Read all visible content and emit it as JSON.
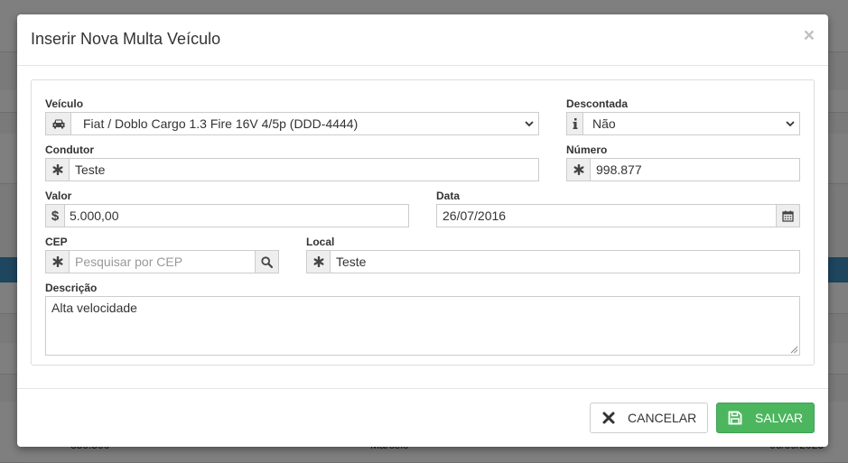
{
  "modal": {
    "title": "Inserir Nova Multa Veículo",
    "close_label": "×"
  },
  "form": {
    "veiculo": {
      "label": "Veículo",
      "value": "Fiat / Doblo Cargo 1.3 Fire 16V 4/5p (DDD-4444)",
      "icon": "car-icon"
    },
    "descontada": {
      "label": "Descontada",
      "value": "Não",
      "icon": "info-icon"
    },
    "condutor": {
      "label": "Condutor",
      "value": "Teste",
      "icon": "asterisk-icon"
    },
    "numero": {
      "label": "Número",
      "value": "998.877",
      "icon": "asterisk-icon"
    },
    "valor": {
      "label": "Valor",
      "value": "5.000,00",
      "icon": "dollar-icon"
    },
    "data": {
      "label": "Data",
      "value": "26/07/2016",
      "icon": "calendar-icon"
    },
    "cep": {
      "label": "CEP",
      "placeholder": "Pesquisar por CEP",
      "icon": "asterisk-icon",
      "search_icon": "search-icon"
    },
    "local": {
      "label": "Local",
      "value": "Teste",
      "icon": "asterisk-icon"
    },
    "descricao": {
      "label": "Descrição",
      "value": "Alta velocidade"
    }
  },
  "footer": {
    "cancel_label": "CANCELAR",
    "save_label": "SALVAR"
  },
  "background": {
    "row_left": "350.500",
    "row_mid": "Marcelo",
    "row_right": "06/09/2023"
  },
  "colors": {
    "save": "#4cb65e",
    "header_blue": "#3c8dbc"
  }
}
